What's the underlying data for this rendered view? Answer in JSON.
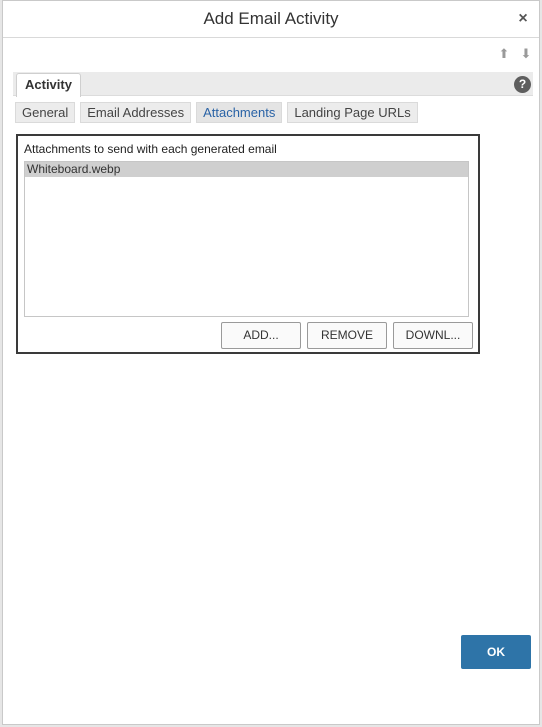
{
  "dialog": {
    "title": "Add Email Activity",
    "close_icon": "×"
  },
  "nav": {
    "up_icon": "⬆",
    "down_icon": "⬇"
  },
  "activity_tab": {
    "label": "Activity",
    "help_icon": "?"
  },
  "subtabs": [
    {
      "label": "General",
      "active": false
    },
    {
      "label": "Email Addresses",
      "active": false
    },
    {
      "label": "Attachments",
      "active": true
    },
    {
      "label": "Landing Page URLs",
      "active": false
    }
  ],
  "attachments": {
    "label": "Attachments to send with each generated email",
    "items": [
      "Whiteboard.webp"
    ],
    "buttons": {
      "add": "ADD...",
      "remove": "REMOVE",
      "download": "DOWNL..."
    }
  },
  "footer": {
    "ok": "OK"
  },
  "colors": {
    "accent": "#2e74a8",
    "active_tab_text": "#2a63a6"
  }
}
